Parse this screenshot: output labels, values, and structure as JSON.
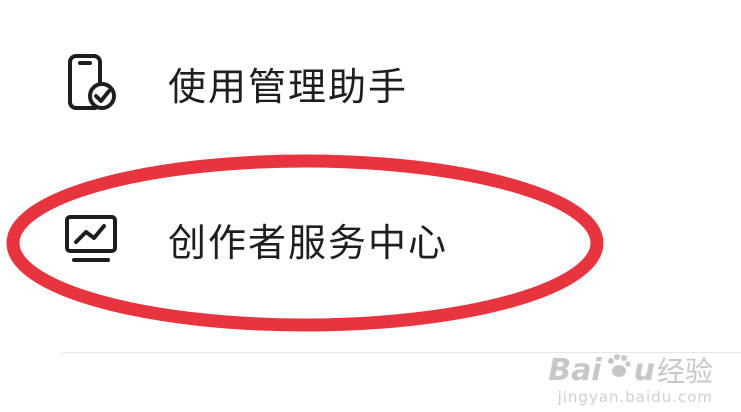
{
  "menu": {
    "items": [
      {
        "label": "使用管理助手",
        "icon": "phone-check-icon"
      },
      {
        "label": "创作者服务中心",
        "icon": "monitor-chart-icon"
      }
    ]
  },
  "annotation": {
    "color": "#e8343f"
  },
  "watermark": {
    "brand_latin_1": "Bai",
    "brand_latin_2": "u",
    "brand_cn": "经验",
    "url": "jingyan.baidu.com"
  }
}
